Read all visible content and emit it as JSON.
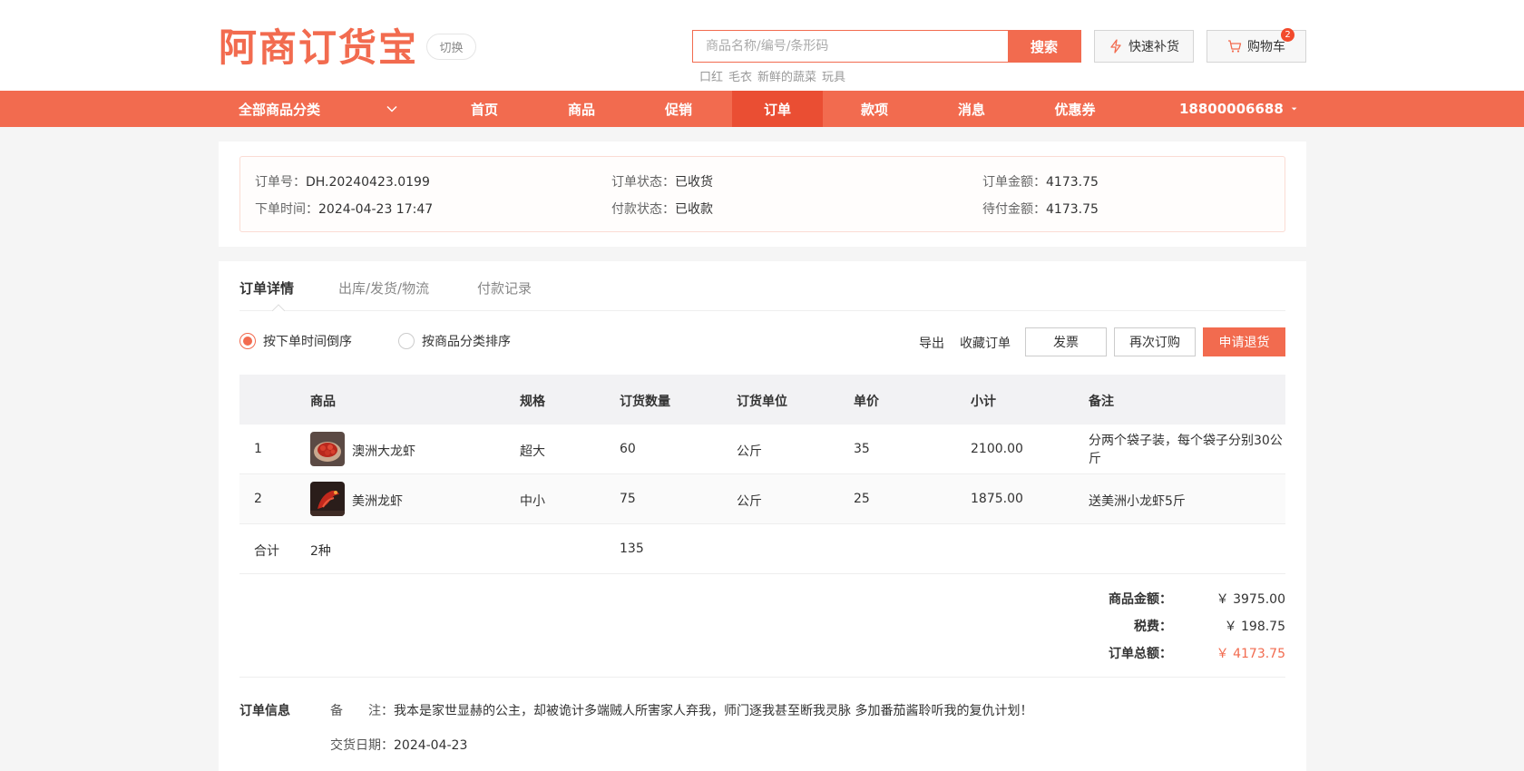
{
  "brand": {
    "logo_text": "阿商订货宝",
    "switch_label": "切换",
    "accent": "#f26b4f"
  },
  "search": {
    "placeholder": "商品名称/编号/条形码",
    "button": "搜索",
    "hotwords": [
      "口红",
      "毛衣",
      "新鲜的蔬菜",
      "玩具"
    ]
  },
  "header_buttons": {
    "quick": "快速补货",
    "cart": "购物车",
    "cart_count": "2",
    "quick_icon": "lightning-icon",
    "cart_icon": "cart-icon"
  },
  "nav": {
    "category": "全部商品分类",
    "items": [
      "首页",
      "商品",
      "促销",
      "订单",
      "款项",
      "消息",
      "优惠券"
    ],
    "active": "订单",
    "user": "18800006688"
  },
  "summary": {
    "order_no_k": "订单号：",
    "order_no": "DH.20240423.0199",
    "time_k": "下单时间：",
    "time": "2024-04-23 17:47",
    "status_k": "订单状态：",
    "status": "已收货",
    "pay_k": "付款状态：",
    "pay": "已收款",
    "amount_k": "订单金额：",
    "amount": "4173.75",
    "due_k": "待付金额：",
    "due": "4173.75"
  },
  "tabs": [
    "订单详情",
    "出库/发货/物流",
    "付款记录"
  ],
  "sort": {
    "by_time": "按下单时间倒序",
    "by_category": "按商品分类排序"
  },
  "actions": {
    "export": "导出",
    "favorite": "收藏订单",
    "invoice": "发票",
    "reorder": "再次订购",
    "refund": "申请退货"
  },
  "table": {
    "headers": [
      "商品",
      "规格",
      "订货数量",
      "订货单位",
      "单价",
      "小计",
      "备注"
    ],
    "rows": [
      {
        "idx": "1",
        "name": "澳洲大龙虾",
        "spec": "超大",
        "qty": "60",
        "unit": "公斤",
        "price": "35",
        "subtotal": "2100.00",
        "note": "分两个袋子装，每个袋子分别30公斤"
      },
      {
        "idx": "2",
        "name": "美洲龙虾",
        "spec": "中小",
        "qty": "75",
        "unit": "公斤",
        "price": "25",
        "subtotal": "1875.00",
        "note": "送美洲小龙虾5斤"
      }
    ],
    "total": {
      "label": "合计",
      "kinds": "2种",
      "qty": "135"
    }
  },
  "totals": {
    "goods_k": "商品金额：",
    "goods": "￥ 3975.00",
    "tax_k": "税费：",
    "tax": "￥ 198.75",
    "total_k": "订单总额：",
    "total": "￥ 4173.75"
  },
  "order_info": {
    "title": "订单信息",
    "remark_k": "备　　注：",
    "remark": "我本是家世显赫的公主，却被诡计多端贼人所害家人弃我，师门逐我甚至断我灵脉 多加番茄酱聆听我的复仇计划！",
    "date_k": "交货日期：",
    "date": "2024-04-23"
  }
}
